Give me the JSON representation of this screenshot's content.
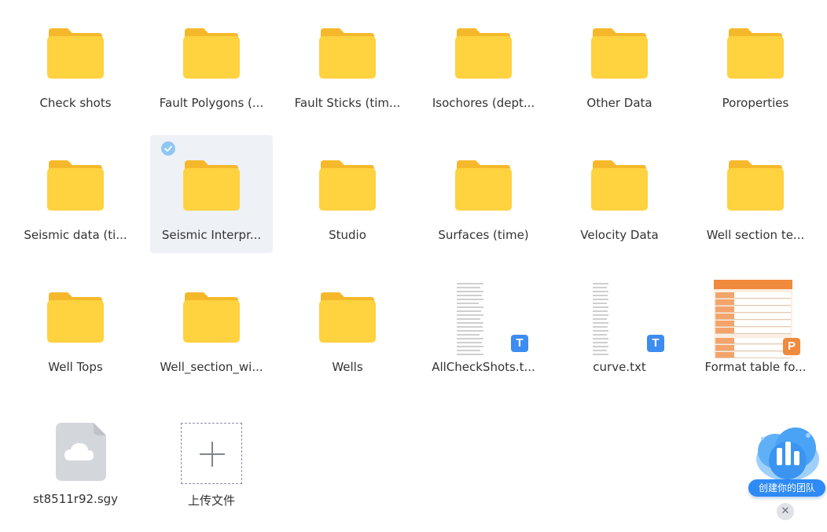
{
  "files": [
    {
      "name": "Check shots",
      "type": "folder"
    },
    {
      "name": "Fault Polygons (...",
      "type": "folder"
    },
    {
      "name": "Fault Sticks (tim...",
      "type": "folder"
    },
    {
      "name": "Isochores (dept...",
      "type": "folder"
    },
    {
      "name": "Other Data",
      "type": "folder"
    },
    {
      "name": "Poroperties",
      "type": "folder"
    },
    {
      "name": "Seismic data (ti...",
      "type": "folder"
    },
    {
      "name": "Seismic Interpr...",
      "type": "folder",
      "selected": true
    },
    {
      "name": "Studio",
      "type": "folder"
    },
    {
      "name": "Surfaces (time)",
      "type": "folder"
    },
    {
      "name": "Velocity Data",
      "type": "folder"
    },
    {
      "name": "Well section te...",
      "type": "folder"
    },
    {
      "name": "Well Tops",
      "type": "folder"
    },
    {
      "name": "Well_section_wi...",
      "type": "folder"
    },
    {
      "name": "Wells",
      "type": "folder"
    },
    {
      "name": "AllCheckShots.t...",
      "type": "txt",
      "badge": "T"
    },
    {
      "name": "curve.txt",
      "type": "txt",
      "badge": "T"
    },
    {
      "name": "Format table fo...",
      "type": "ppt",
      "badge": "P"
    },
    {
      "name": "st8511r92.sgy",
      "type": "sgy"
    }
  ],
  "upload": {
    "label": "上传文件"
  },
  "promo": {
    "label": "创建你的团队",
    "close": "✕"
  },
  "colors": {
    "folder": "#ffd23f",
    "folder_back": "#f6b82b",
    "selected_bg": "#eef1f6",
    "accent": "#3d8cf0"
  }
}
